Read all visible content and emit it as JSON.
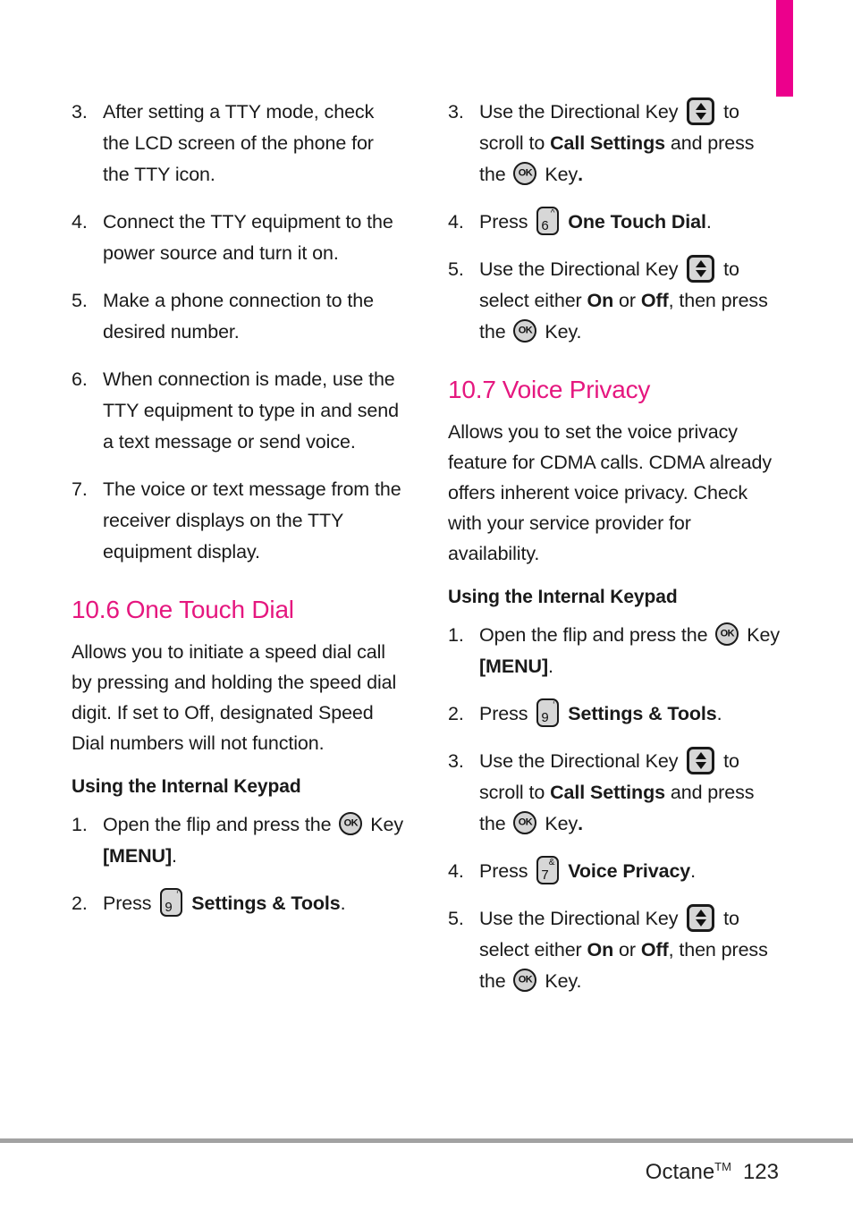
{
  "page": {
    "number": "123",
    "product_name": "Octane",
    "trademark": "TM",
    "accent_color": "#ec008c",
    "heading_color": "#e5177f"
  },
  "tab_marker": {
    "color": "#ec008c"
  },
  "left_column": {
    "continued_steps": [
      {
        "marker": "3.",
        "text": "After setting a TTY mode, check the LCD screen of the phone for the TTY icon."
      },
      {
        "marker": "4.",
        "text": "Connect the TTY equipment to the power source and turn it on."
      },
      {
        "marker": "5.",
        "text": "Make a phone connection to the desired number."
      },
      {
        "marker": "6.",
        "text": "When connection is made, use the TTY equipment to type in and send a text message or send voice."
      },
      {
        "marker": "7.",
        "text": "The voice or text message from the receiver displays on the TTY equipment display."
      }
    ],
    "section": {
      "number": "10.6",
      "title": "One Touch Dial",
      "intro": "Allows you to initiate a speed dial call by pressing and holding the speed dial digit. If set to Off, designated Speed Dial numbers will not function.",
      "subheading": "Using the Internal Keypad",
      "steps": {
        "step1": {
          "marker": "1.",
          "part1": "Open the flip and press the",
          "part2": "Key",
          "bold": "[MENU]",
          "end": "."
        },
        "step2": {
          "marker": "2.",
          "part1": "Press",
          "key_digit": "9",
          "key_sup": "‘",
          "bold": "Settings & Tools",
          "end": "."
        }
      }
    }
  },
  "right_column": {
    "continued_steps": {
      "step3": {
        "marker": "3.",
        "part1": "Use the Directional Key",
        "part2": "to scroll to",
        "bold1": "Call Settings",
        "part3": "and press the",
        "part4": "Key",
        "end": "."
      },
      "step4": {
        "marker": "4.",
        "part1": "Press",
        "key_digit": "6",
        "key_sup": "^",
        "bold": "One Touch Dial",
        "end": "."
      },
      "step5": {
        "marker": "5.",
        "part1": "Use the Directional Key",
        "part2": "to select either",
        "bold1": "On",
        "part3": "or",
        "bold2": "Off",
        "part4": ", then press the",
        "part5": "Key",
        "end": "."
      }
    },
    "section": {
      "number": "10.7",
      "title": "Voice Privacy",
      "intro": "Allows you to set the voice privacy feature for CDMA calls. CDMA already offers inherent voice privacy. Check with your service provider for availability.",
      "subheading": "Using the Internal Keypad",
      "steps": {
        "step1": {
          "marker": "1.",
          "part1": "Open the flip and press the",
          "part2": "Key",
          "bold": "[MENU]",
          "end": "."
        },
        "step2": {
          "marker": "2.",
          "part1": "Press",
          "key_digit": "9",
          "key_sup": "‘",
          "bold": "Settings & Tools",
          "end": "."
        },
        "step3": {
          "marker": "3.",
          "part1": "Use the Directional Key",
          "part2": "to scroll to",
          "bold1": "Call Settings",
          "part3": "and press the",
          "part4": "Key",
          "end": "."
        },
        "step4": {
          "marker": "4.",
          "part1": "Press",
          "key_digit": "7",
          "key_sup": "&",
          "bold": "Voice Privacy",
          "end": "."
        },
        "step5": {
          "marker": "5.",
          "part1": "Use the Directional Key",
          "part2": "to select either",
          "bold1": "On",
          "part3": "or",
          "bold2": "Off",
          "part4": ", then press the",
          "part5": "Key",
          "end": "."
        }
      }
    }
  }
}
